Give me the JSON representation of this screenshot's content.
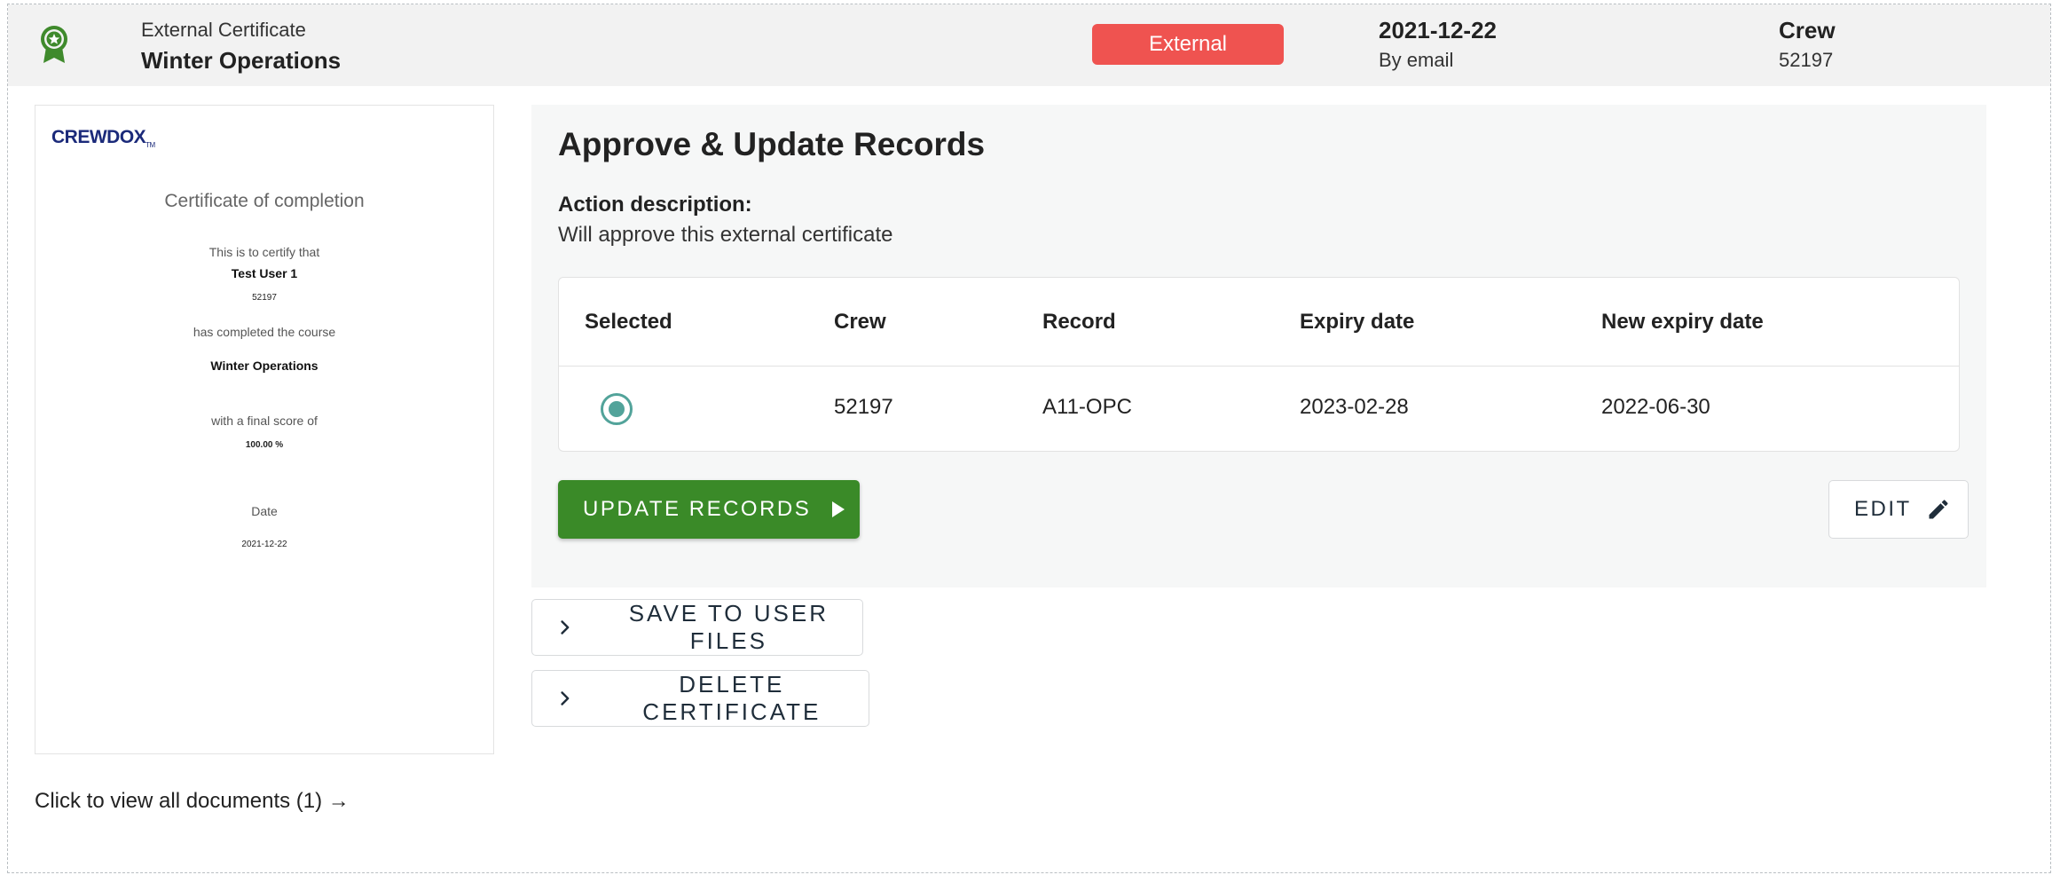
{
  "header": {
    "type_label": "External Certificate",
    "certificate_name": "Winter Operations",
    "status": "External",
    "date": "2021-12-22",
    "method": "By email",
    "role_label": "Crew",
    "crew_id": "52197",
    "status_color": "#ef5350",
    "icon": "award-ribbon-icon"
  },
  "preview": {
    "logo": "CREWDOX",
    "logo_mark": "TM",
    "title": "Certificate of completion",
    "intro": "This is to certify that",
    "user_name": "Test User 1",
    "user_id": "52197",
    "completed_text": "has completed the course",
    "course": "Winter Operations",
    "score_label": "with a final score of",
    "score": "100.00 %",
    "date_label": "Date",
    "date": "2021-12-22"
  },
  "view_docs_link": "Click to view all documents (1) →",
  "panel": {
    "title": "Approve & Update Records",
    "action_label": "Action description:",
    "action_desc": "Will approve this external certificate",
    "table": {
      "columns": [
        "Selected",
        "Crew",
        "Record",
        "Expiry date",
        "New expiry date"
      ],
      "rows": [
        {
          "selected": true,
          "crew": "52197",
          "record": "A11-OPC",
          "expiry": "2023-02-28",
          "new_expiry": "2022-06-30"
        }
      ]
    },
    "update_button": "UPDATE RECORDS",
    "edit_button": "EDIT",
    "accent_color": "#3a8a28"
  },
  "actions": {
    "save": "SAVE TO USER FILES",
    "delete": "DELETE CERTIFICATE"
  }
}
